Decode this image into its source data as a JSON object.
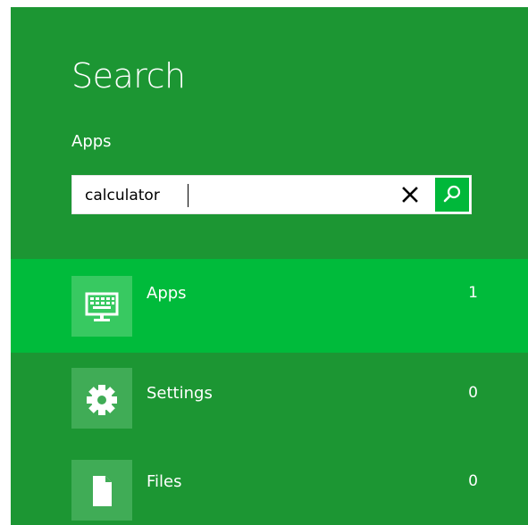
{
  "search": {
    "title": "Search",
    "scope_label": "Apps",
    "query": "calculator"
  },
  "results": [
    {
      "label": "Apps",
      "count": "1",
      "icon": "apps-icon",
      "selected": true
    },
    {
      "label": "Settings",
      "count": "0",
      "icon": "gear-icon",
      "selected": false
    },
    {
      "label": "Files",
      "count": "0",
      "icon": "file-icon",
      "selected": false
    }
  ],
  "colors": {
    "pane_background": "#1c9633",
    "selected_row": "#00bb3b",
    "accent_button": "#00b83a",
    "text": "#ffffff"
  }
}
